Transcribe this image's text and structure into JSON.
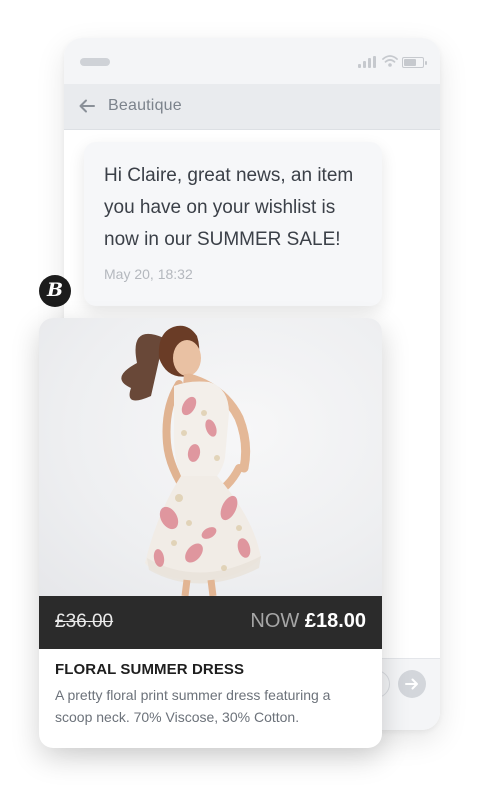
{
  "app": {
    "title": "Beautique"
  },
  "message": {
    "text": "Hi Claire, great news, an item you have on your wishlist is now in our SUMMER SALE!",
    "timestamp": "May 20, 18:32"
  },
  "brand": {
    "badge_letter": "B"
  },
  "product": {
    "old_price": "£36.00",
    "now_label": "NOW",
    "new_price": "£18.00",
    "title": "FLORAL SUMMER DRESS",
    "description": "A pretty floral print summer dress featuring a scoop neck. 70% Viscose, 30% Cotton."
  },
  "icons": {
    "back": "arrow-left-icon",
    "send": "arrow-right-icon",
    "signal": "signal-icon",
    "wifi": "wifi-icon",
    "battery": "battery-icon"
  },
  "status": {
    "battery_level": 0.6
  },
  "colors": {
    "price_bar": "#2b2b2b",
    "nav_bar": "#e9ebee",
    "badge": "#1c1c1c"
  }
}
